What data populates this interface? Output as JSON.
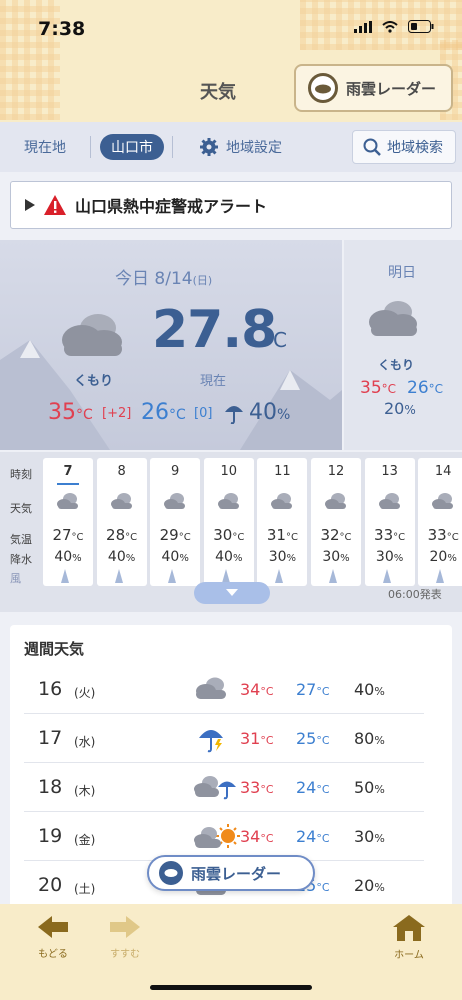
{
  "status": {
    "time": "7:38"
  },
  "header": {
    "title": "天気",
    "radar_label": "雨雲レーダー"
  },
  "tabs": [
    {
      "label": "現在地"
    },
    {
      "label": "山口市"
    },
    {
      "label": "地域設定"
    }
  ],
  "search": {
    "label": "地域検索"
  },
  "alert": {
    "text": "山口県熱中症警戒アラート"
  },
  "today": {
    "label": "今日",
    "date": "8/14",
    "dow": "(日)",
    "current_temp": "27.8",
    "temp_unit": "°C",
    "now_label": "現在",
    "weather": "くもり",
    "high": "35",
    "high_diff": "[+2]",
    "low": "26",
    "low_diff": "[0]",
    "rain": "40",
    "unit_c": "°C",
    "unit_pct": "%"
  },
  "tomorrow": {
    "label": "明日",
    "weather": "くもり",
    "high": "35",
    "low": "26",
    "rain": "20"
  },
  "hourly": {
    "labels": {
      "time": "時刻",
      "weather": "天気",
      "temp": "気温",
      "precip": "降水",
      "wind": "風"
    },
    "hours": [
      {
        "hour": "7",
        "temp": "27",
        "precip": "40"
      },
      {
        "hour": "8",
        "temp": "28",
        "precip": "40"
      },
      {
        "hour": "9",
        "temp": "29",
        "precip": "40"
      },
      {
        "hour": "10",
        "temp": "30",
        "precip": "40"
      },
      {
        "hour": "11",
        "temp": "31",
        "precip": "30"
      },
      {
        "hour": "12",
        "temp": "32",
        "precip": "30"
      },
      {
        "hour": "13",
        "temp": "33",
        "precip": "30"
      },
      {
        "hour": "14",
        "temp": "33",
        "precip": "20"
      }
    ],
    "issued": "06:00発表"
  },
  "weekly": {
    "title": "週間天気",
    "days": [
      {
        "day": "16",
        "dow": "(火)",
        "icon": "cloud-icon",
        "high": "34",
        "low": "27",
        "precip": "40"
      },
      {
        "day": "17",
        "dow": "(水)",
        "icon": "umbrella-icon",
        "high": "31",
        "low": "25",
        "precip": "80"
      },
      {
        "day": "18",
        "dow": "(木)",
        "icon": "cloud-umbrella-icon",
        "high": "33",
        "low": "24",
        "precip": "50"
      },
      {
        "day": "19",
        "dow": "(金)",
        "icon": "cloud-sun-icon",
        "high": "34",
        "low": "24",
        "precip": "30"
      },
      {
        "day": "20",
        "dow": "(土)",
        "icon": "cloud-icon",
        "high": "",
        "low": "25",
        "precip": "20"
      }
    ]
  },
  "float_radar": {
    "label": "雨雲レーダー"
  },
  "nav": {
    "back": "もどる",
    "forward": "すすむ",
    "home": "ホーム"
  },
  "colors": {
    "accent": "#3c5f92",
    "high": "#e04050",
    "low": "#3c7fd0",
    "header_bg": "#f8ecc9"
  }
}
